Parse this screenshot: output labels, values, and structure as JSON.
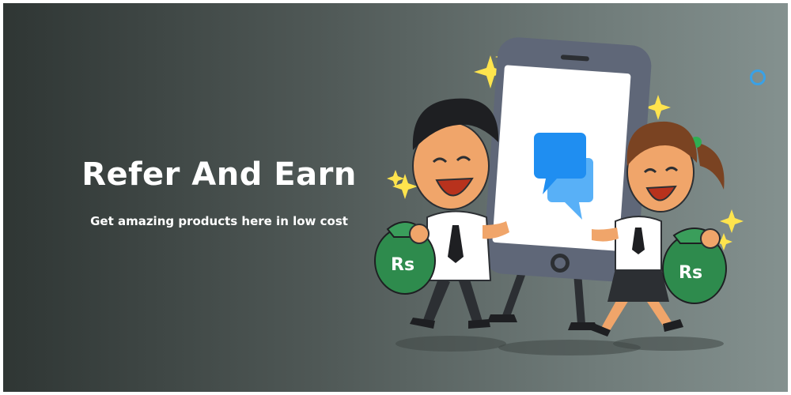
{
  "banner": {
    "title": "Refer And Earn",
    "subtitle": "Get amazing products here in low cost"
  },
  "illustration": {
    "left_bag_label": "Rs",
    "right_bag_label": "Rs",
    "icon": "chat-bubbles-icon"
  },
  "colors": {
    "accent_blue": "#1f8ef1",
    "bag_green": "#2e8b4d",
    "ring": "#3aa1e6"
  }
}
